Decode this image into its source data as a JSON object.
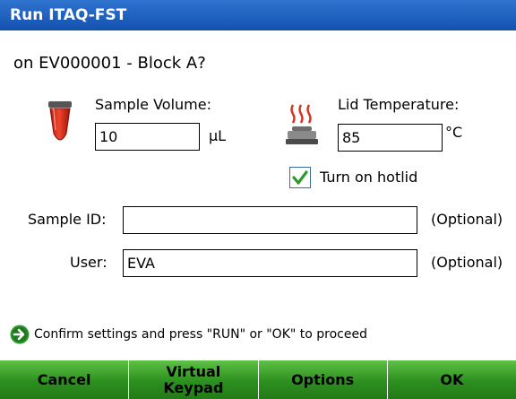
{
  "window": {
    "title": "Run ITAQ-FST",
    "subtitle": "on EV000001 - Block A?"
  },
  "sample_volume": {
    "label": "Sample Volume:",
    "value": "10",
    "unit": "µL"
  },
  "lid_temperature": {
    "label": "Lid Temperature:",
    "value": "85",
    "unit": "°C"
  },
  "hotlid": {
    "label": "Turn on hotlid",
    "checked": true
  },
  "sample_id": {
    "label": "Sample ID:",
    "value": "",
    "note": "(Optional)"
  },
  "user": {
    "label": "User:",
    "value": "EVA",
    "note": "(Optional)"
  },
  "hint": {
    "text": "Confirm settings and press \"RUN\" or \"OK\" to proceed"
  },
  "softkeys": [
    {
      "label": "Cancel"
    },
    {
      "label": "Virtual\nKeypad"
    },
    {
      "label": "Options"
    },
    {
      "label": "OK"
    }
  ],
  "colors": {
    "titlebar": "#1f5fbf",
    "softkey": "#2c8f1f",
    "tube": "#e0331f",
    "heat_waves": "#d8331f",
    "hint_arrow": "#2e9a2e"
  },
  "icons": {
    "tube": "sample-tube-icon",
    "heater": "heated-lid-icon",
    "hint": "arrow-right-circle-icon",
    "check": "checkmark-icon"
  }
}
